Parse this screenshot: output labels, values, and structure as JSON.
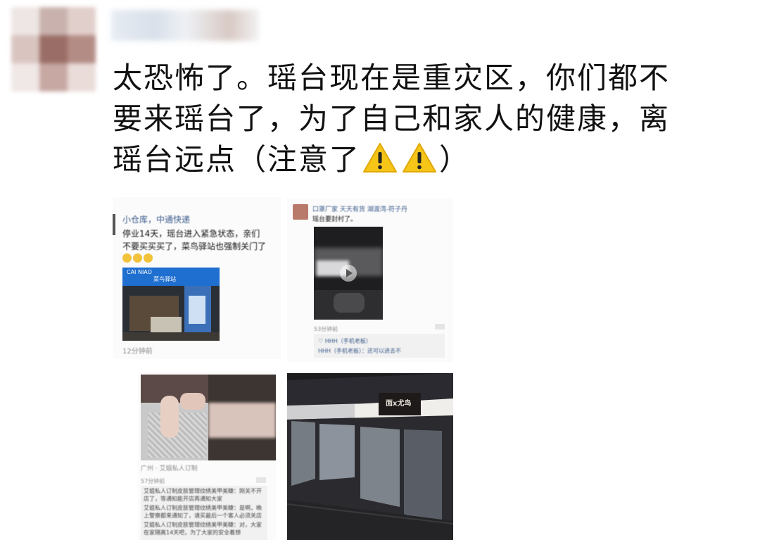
{
  "post": {
    "text_line1": "太恐怖了。瑶台现在是重灾区，你们都不",
    "text_line2": "要来瑶台了，为了自己和家人的健康，离",
    "text_line3_a": "瑶台远点（注意了",
    "text_line3_b": "）"
  },
  "photo1": {
    "poster": "小仓库，中通快递",
    "text_line1": "停业14天，瑶台进入紧急状态，亲们",
    "text_line2": "不要买买买了，菜鸟驿站也强制关门了",
    "sign_logo": "CAI NIAO",
    "sign_text": "菜鸟驿站",
    "timestamp": "12分钟前"
  },
  "photo2": {
    "poster": "口罩厂家 天天有货  湖渡湾-符子丹",
    "text": "瑶台要封村了。",
    "timestamp": "53分钟前",
    "like_line": "♡ HHH（手机老板）",
    "comment_line": "HHH（手机老板）：还可以进去不"
  },
  "photo3": {
    "poster": "广州 · 艾姐私人订制",
    "timestamp": "57分钟前",
    "comment1": "艾姐私人订制皮肤管理纹绣美甲美睫：刚关不开店了，等通知能开店再通知大家",
    "comment2": "艾姐私人订制皮肤管理纹绣美甲美睫：是啊，晚上警察都来通知了，请买最后一个客人必须关店",
    "comment3": "艾姐私人订制皮肤管理纹绣美甲美睫：对，大家在家隔离14天吧，为了大家的安全着想"
  },
  "photo4": {
    "shop_sign": "面x尤鸟"
  },
  "colors": {
    "warning_yellow": "#f5c518",
    "text": "#111111",
    "shutter": "#8d939c"
  }
}
